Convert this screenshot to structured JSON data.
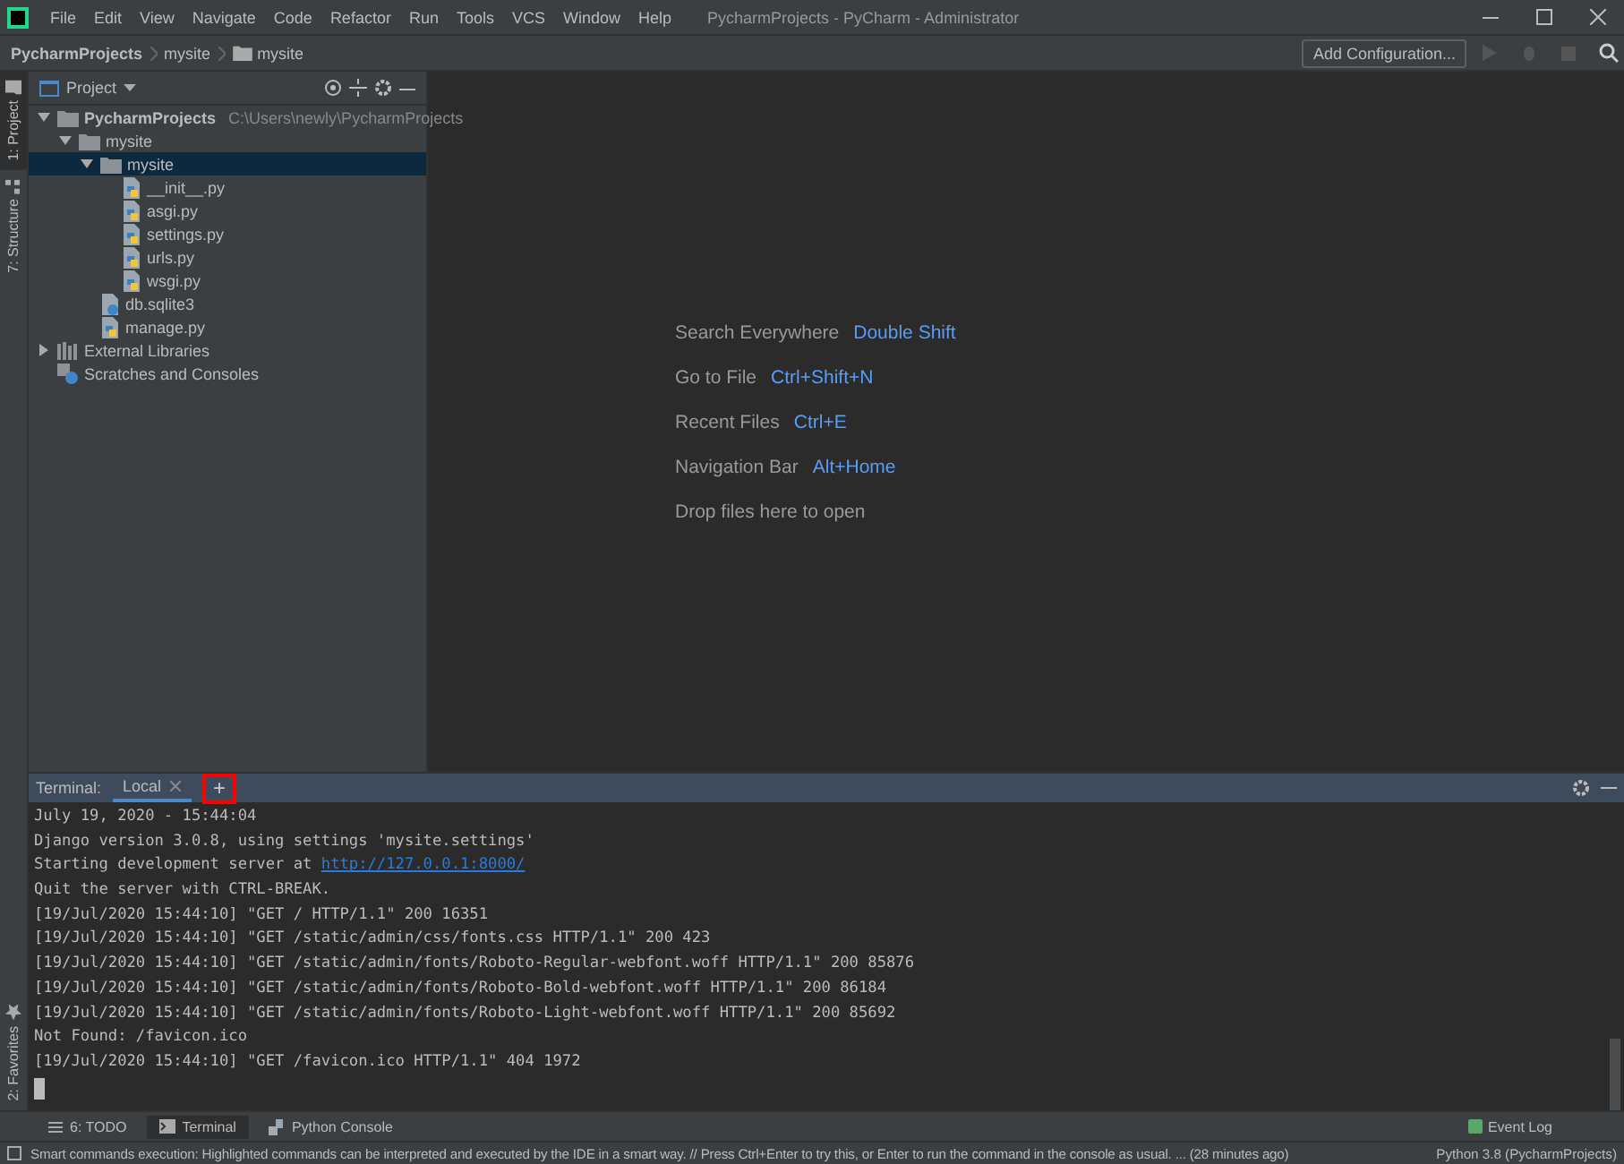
{
  "window": {
    "title": "PycharmProjects - PyCharm - Administrator"
  },
  "menu": [
    "File",
    "Edit",
    "View",
    "Navigate",
    "Code",
    "Refactor",
    "Run",
    "Tools",
    "VCS",
    "Window",
    "Help"
  ],
  "breadcrumbs": [
    {
      "label": "PycharmProjects",
      "kind": "root"
    },
    {
      "label": "mysite",
      "kind": "plain"
    },
    {
      "label": "mysite",
      "kind": "folder"
    }
  ],
  "toolbar": {
    "configuration": "Add Configuration..."
  },
  "left_strip": [
    {
      "label": "1: Project",
      "selected": true
    },
    {
      "label": "7: Structure",
      "selected": false
    }
  ],
  "left_strip_bottom": [
    {
      "label": "2: Favorites",
      "selected": false
    }
  ],
  "project_panel": {
    "title": "Project",
    "tree": [
      {
        "label": "PycharmProjects",
        "hint": "C:\\Users\\newly\\PycharmProjects",
        "kind": "root",
        "expanded": true,
        "selected": false,
        "children": [
          {
            "label": "mysite",
            "kind": "folder",
            "expanded": true,
            "selected": false,
            "children": [
              {
                "label": "mysite",
                "kind": "folder",
                "expanded": true,
                "selected": true,
                "children": [
                  {
                    "label": "__init__.py",
                    "kind": "python",
                    "selected": false
                  },
                  {
                    "label": "asgi.py",
                    "kind": "python",
                    "selected": false
                  },
                  {
                    "label": "settings.py",
                    "kind": "python",
                    "selected": false
                  },
                  {
                    "label": "urls.py",
                    "kind": "python",
                    "selected": false
                  },
                  {
                    "label": "wsgi.py",
                    "kind": "python",
                    "selected": false
                  }
                ]
              },
              {
                "label": "db.sqlite3",
                "kind": "unknown",
                "selected": false
              },
              {
                "label": "manage.py",
                "kind": "python",
                "selected": false
              }
            ]
          }
        ]
      },
      {
        "label": "External Libraries",
        "kind": "libraries",
        "expanded": false,
        "selected": false
      },
      {
        "label": "Scratches and Consoles",
        "kind": "scratches",
        "selected": false
      }
    ]
  },
  "editor_hints": [
    {
      "label": "Search Everywhere",
      "shortcut": "Double Shift"
    },
    {
      "label": "Go to File",
      "shortcut": "Ctrl+Shift+N"
    },
    {
      "label": "Recent Files",
      "shortcut": "Ctrl+E"
    },
    {
      "label": "Navigation Bar",
      "shortcut": "Alt+Home"
    },
    {
      "label": "Drop files here to open"
    }
  ],
  "terminal": {
    "title": "Terminal:",
    "tabs": [
      {
        "label": "Local",
        "selected": true
      }
    ],
    "new_tab_button": {
      "label": "+",
      "highlighted": true
    },
    "lines": [
      {
        "text": "July 19, 2020 - 15:44:04"
      },
      {
        "text": "Django version 3.0.8, using settings 'mysite.settings'"
      },
      {
        "text": "Starting development server at ",
        "link": "http://127.0.0.1:8000/"
      },
      {
        "text": "Quit the server with CTRL-BREAK."
      },
      {
        "text": "[19/Jul/2020 15:44:10] \"GET / HTTP/1.1\" 200 16351"
      },
      {
        "text": "[19/Jul/2020 15:44:10] \"GET /static/admin/css/fonts.css HTTP/1.1\" 200 423"
      },
      {
        "text": "[19/Jul/2020 15:44:10] \"GET /static/admin/fonts/Roboto-Regular-webfont.woff HTTP/1.1\" 200 85876"
      },
      {
        "text": "[19/Jul/2020 15:44:10] \"GET /static/admin/fonts/Roboto-Bold-webfont.woff HTTP/1.1\" 200 86184"
      },
      {
        "text": "[19/Jul/2020 15:44:10] \"GET /static/admin/fonts/Roboto-Light-webfont.woff HTTP/1.1\" 200 85692"
      },
      {
        "text": "Not Found: /favicon.ico"
      },
      {
        "text": "[19/Jul/2020 15:44:10] \"GET /favicon.ico HTTP/1.1\" 404 1972"
      }
    ]
  },
  "bottom_tabs": [
    {
      "label": "6: TODO",
      "kind": "list",
      "selected": false
    },
    {
      "label": "Terminal",
      "kind": "terminal",
      "selected": true
    },
    {
      "label": "Python Console",
      "kind": "python",
      "selected": false
    }
  ],
  "event_log": "Event Log",
  "status_bar": {
    "message": "Smart commands execution: Highlighted commands can be interpreted and executed by the IDE in a smart way. // Press Ctrl+Enter to try this, or Enter to run the command in the console as usual. ... (28 minutes ago)",
    "interpreter": "Python 3.8 (PycharmProjects)"
  }
}
